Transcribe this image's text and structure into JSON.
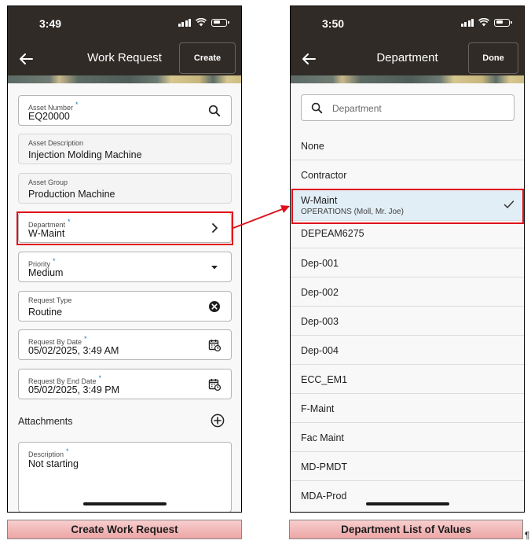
{
  "left_screen": {
    "status_time": "3:49",
    "title": "Work Request",
    "action_button": "Create",
    "fields": [
      {
        "label": "Asset Number",
        "value": "EQ20000",
        "required": "*",
        "icon": "search-icon"
      },
      {
        "label": "Asset Description",
        "value": "Injection Molding Machine"
      },
      {
        "label": "Asset Group",
        "value": "Production Machine"
      },
      {
        "label": "Department",
        "value": "W-Maint",
        "required": "*",
        "icon": "chevron-right-icon"
      },
      {
        "label": "Priority",
        "value": "Medium",
        "required": "*",
        "icon": "dropdown-caret-icon"
      },
      {
        "label": "Request Type",
        "value": "Routine",
        "icon": "clear-icon"
      },
      {
        "label": "Request By Date",
        "value": "05/02/2025, 3:49 AM",
        "required": "*",
        "icon": "calendar-icon"
      },
      {
        "label": "Request By End Date",
        "value": "05/02/2025, 3:49 PM",
        "required": "*",
        "icon": "calendar-icon"
      }
    ],
    "attachments_label": "Attachments",
    "description": {
      "label": "Description",
      "required": "*",
      "value": "Not starting"
    }
  },
  "right_screen": {
    "status_time": "3:50",
    "title": "Department",
    "action_button": "Done",
    "search_placeholder": "Department",
    "items": [
      {
        "label": "None"
      },
      {
        "label": "Contractor"
      },
      {
        "label": "W-Maint",
        "sublabel": "OPERATIONS (Moll, Mr. Joe)",
        "selected": true
      },
      {
        "label": "DEPEAM6275"
      },
      {
        "label": "Dep-001"
      },
      {
        "label": "Dep-002"
      },
      {
        "label": "Dep-003"
      },
      {
        "label": "Dep-004"
      },
      {
        "label": "ECC_EM1"
      },
      {
        "label": "F-Maint"
      },
      {
        "label": "Fac Maint"
      },
      {
        "label": "MD-PMDT"
      },
      {
        "label": "MDA-Prod"
      }
    ]
  },
  "captions": {
    "left": "Create Work Request",
    "right": "Department List of Values"
  },
  "pilcrow": "¶",
  "colors": {
    "header": "#302b27",
    "highlight": "#e0101a",
    "required_marker": "#227fbd",
    "selected_row": "#e2eef6",
    "caption_fill": "#eca5a5"
  }
}
